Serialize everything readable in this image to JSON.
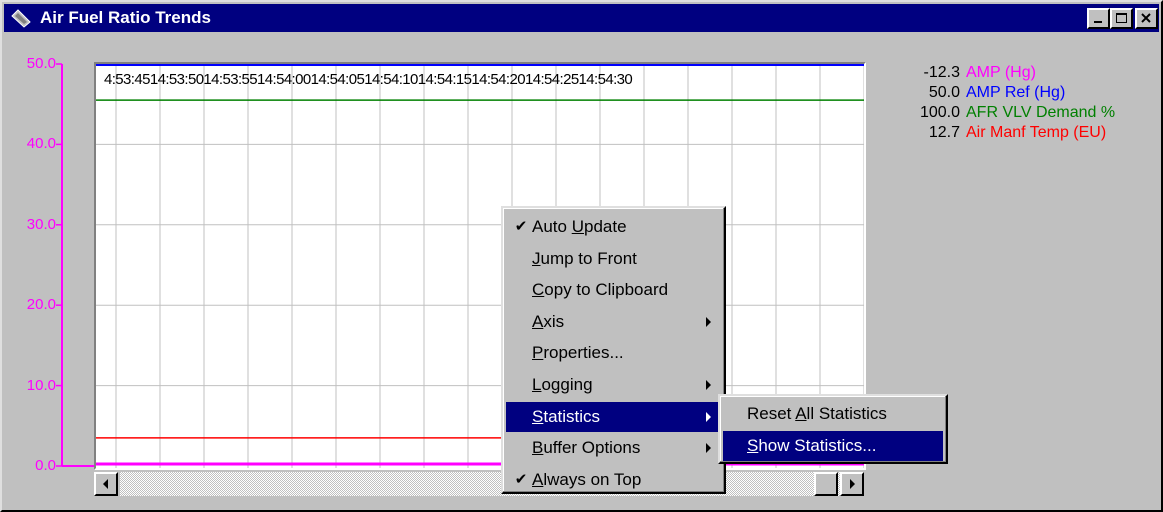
{
  "window": {
    "title": "Air Fuel Ratio Trends",
    "buttons": {
      "minimize": "minimize-icon",
      "maximize": "maximize-icon",
      "close": "close-icon"
    }
  },
  "colors": {
    "titlebar": "#000080",
    "axis": "#ff00ff",
    "amp": "#ff00ff",
    "amp_ref": "#0000ff",
    "afr_vlv": "#008000",
    "air_manf": "#ff0000",
    "grid": "#c0c0c0"
  },
  "chart_data": {
    "type": "line",
    "ylim": [
      0,
      50
    ],
    "y_ticks": [
      "50.0",
      "40.0",
      "30.0",
      "20.0",
      "10.0",
      "0.0"
    ],
    "x_time_labels": "4:53:4514:53:5014:53:5514:54:0014:54:0514:54:1014:54:1514:54:2014:54:2514:54:30",
    "series": [
      {
        "name": "AMP (Hg)",
        "value": 0,
        "color": "#ff00ff"
      },
      {
        "name": "AMP Ref (Hg)",
        "value": 50,
        "color": "#0000ff"
      },
      {
        "name": "AFR VLV Demand %",
        "value": 45.5,
        "color": "#008000"
      },
      {
        "name": "Air Manf Temp (EU)",
        "value": 3.5,
        "color": "#ff0000"
      }
    ]
  },
  "legend": [
    {
      "value": "-12.3",
      "name": "AMP (Hg)",
      "color": "#ff00ff"
    },
    {
      "value": "50.0",
      "name": "AMP Ref (Hg)",
      "color": "#0000ff"
    },
    {
      "value": "100.0",
      "name": "AFR VLV Demand %",
      "color": "#008000"
    },
    {
      "value": "12.7",
      "name": "Air Manf Temp (EU)",
      "color": "#ff0000"
    }
  ],
  "context_menu": {
    "items": [
      {
        "pre": "Auto ",
        "ul": "U",
        "post": "pdate",
        "checked": true,
        "submenu": false,
        "highlighted": false
      },
      {
        "pre": "",
        "ul": "J",
        "post": "ump to Front",
        "checked": false,
        "submenu": false,
        "highlighted": false
      },
      {
        "pre": "",
        "ul": "C",
        "post": "opy to Clipboard",
        "checked": false,
        "submenu": false,
        "highlighted": false
      },
      {
        "pre": "",
        "ul": "A",
        "post": "xis",
        "checked": false,
        "submenu": true,
        "highlighted": false
      },
      {
        "pre": "",
        "ul": "P",
        "post": "roperties...",
        "checked": false,
        "submenu": false,
        "highlighted": false
      },
      {
        "pre": "",
        "ul": "L",
        "post": "ogging",
        "checked": false,
        "submenu": true,
        "highlighted": false
      },
      {
        "pre": "",
        "ul": "S",
        "post": "tatistics",
        "checked": false,
        "submenu": true,
        "highlighted": true
      },
      {
        "pre": "",
        "ul": "B",
        "post": "uffer Options",
        "checked": false,
        "submenu": true,
        "highlighted": false
      },
      {
        "pre": "",
        "ul": "A",
        "post": "lways on Top",
        "checked": true,
        "submenu": false,
        "highlighted": false
      }
    ],
    "check_glyph": "✔"
  },
  "statistics_submenu": {
    "items": [
      {
        "pre": "Reset ",
        "ul": "A",
        "post": "ll Statistics",
        "highlighted": false
      },
      {
        "pre": "",
        "ul": "S",
        "post": "how Statistics...",
        "highlighted": true
      }
    ]
  }
}
